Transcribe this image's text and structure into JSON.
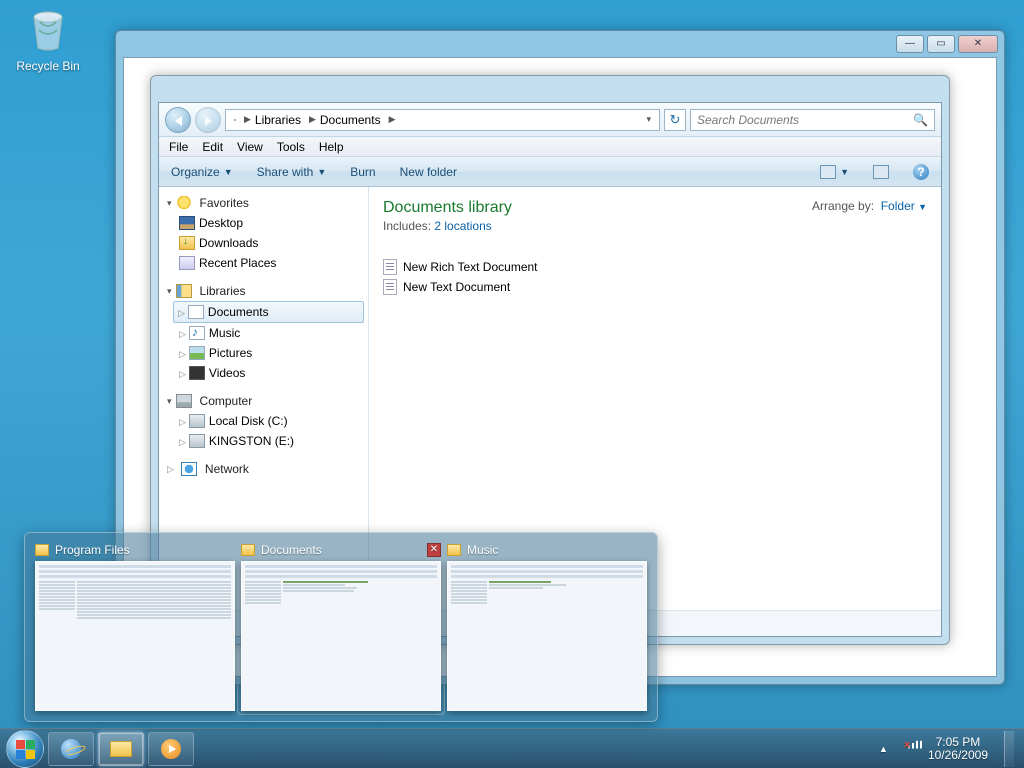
{
  "desktop": {
    "recycle_bin": "Recycle Bin"
  },
  "back_window": {},
  "explorer": {
    "breadcrumb": [
      "Libraries",
      "Documents"
    ],
    "search_placeholder": "Search Documents",
    "menu": {
      "file": "File",
      "edit": "Edit",
      "view": "View",
      "tools": "Tools",
      "help": "Help"
    },
    "commands": {
      "organize": "Organize",
      "share": "Share with",
      "burn": "Burn",
      "newfolder": "New folder"
    },
    "nav": {
      "favorites": {
        "label": "Favorites",
        "items": [
          "Desktop",
          "Downloads",
          "Recent Places"
        ]
      },
      "libraries": {
        "label": "Libraries",
        "items": [
          "Documents",
          "Music",
          "Pictures",
          "Videos"
        ],
        "selected": "Documents"
      },
      "computer": {
        "label": "Computer",
        "items": [
          "Local Disk (C:)",
          "KINGSTON (E:)"
        ]
      },
      "network": {
        "label": "Network"
      }
    },
    "library_header": {
      "title": "Documents library",
      "includes_label": "Includes:",
      "includes_link": "2 locations"
    },
    "arrange": {
      "label": "Arrange by:",
      "value": "Folder"
    },
    "files": [
      "New Rich Text Document",
      "New Text Document"
    ]
  },
  "thumbnails": [
    {
      "title": "Program Files",
      "active": false,
      "close": false
    },
    {
      "title": "Documents",
      "active": true,
      "close": true
    },
    {
      "title": "Music",
      "active": false,
      "close": false
    }
  ],
  "taskbar": {
    "pinned": [
      "internet-explorer",
      "file-explorer",
      "windows-media-player"
    ],
    "active": "file-explorer",
    "tray_icons": [
      "action-center-flag",
      "network",
      "volume"
    ],
    "clock": {
      "time": "7:05 PM",
      "date": "10/26/2009"
    }
  }
}
